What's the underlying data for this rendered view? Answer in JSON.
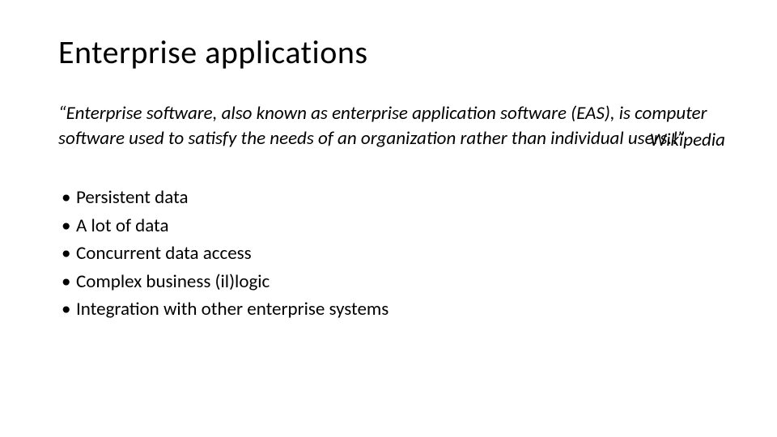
{
  "slide": {
    "title": "Enterprise applications",
    "quote": "“Enterprise software, also known as enterprise application software (EAS), is computer software used to satisfy the needs of an organization rather than individual users.!”",
    "attribution": "Wikipedia",
    "bullets": [
      "Persistent data",
      "A lot of data",
      "Concurrent data access",
      "Complex business (il)logic",
      "Integration with other enterprise systems"
    ]
  }
}
